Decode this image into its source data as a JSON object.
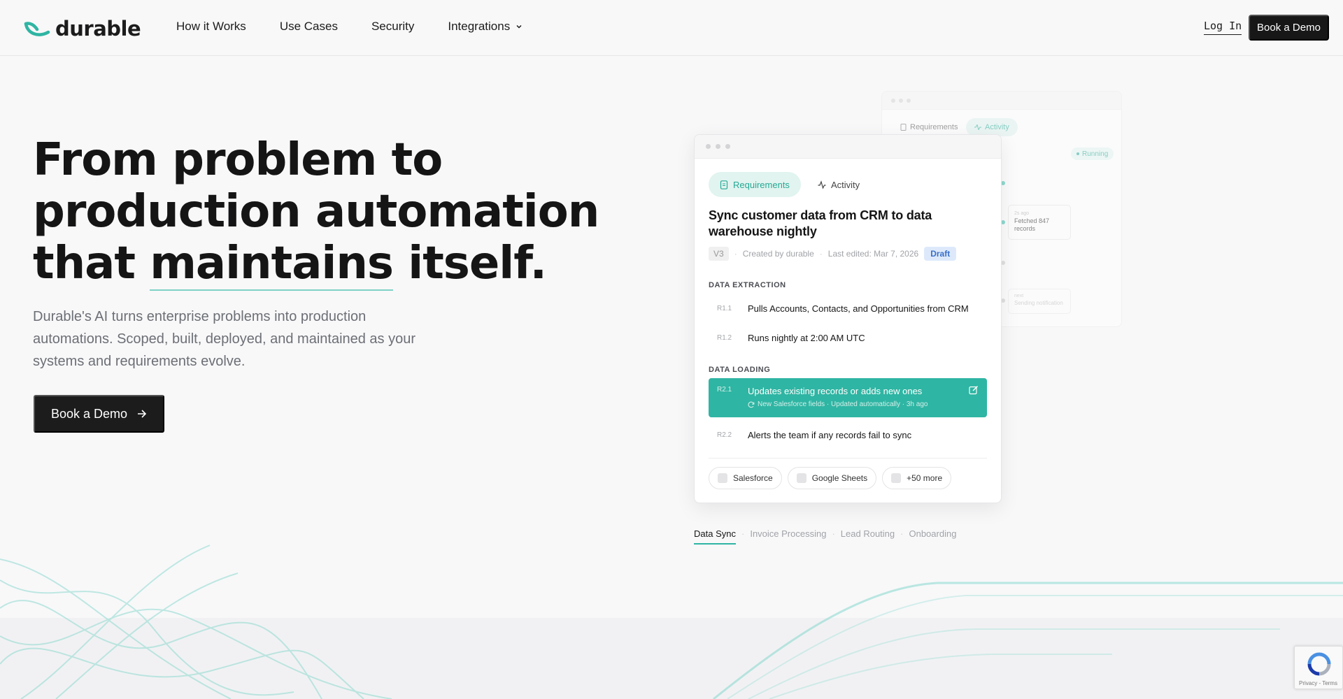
{
  "nav": {
    "logo_text": "durable",
    "links": [
      "How it Works",
      "Use Cases",
      "Security",
      "Integrations"
    ],
    "login": "Log In",
    "demo": "Book a Demo"
  },
  "hero": {
    "title_part1": "From problem to production automation that ",
    "title_highlight": "maintains",
    "title_part2": " itself.",
    "subtitle": "Durable's AI turns enterprise problems into production automations. Scoped, built, deployed, and maintained as your systems and requirements evolve.",
    "cta": "Book a Demo"
  },
  "back_card": {
    "tab_requirements": "Requirements",
    "tab_activity": "Activity",
    "status": "Running",
    "fetch_time": "2s ago",
    "fetch_text": "Fetched 847 records",
    "notify_time": "next",
    "notify_text": "Sending notification"
  },
  "card": {
    "tab_requirements": "Requirements",
    "tab_activity": "Activity",
    "title": "Sync customer data from CRM to data warehouse nightly",
    "version": "V3",
    "created_by": "Created by durable",
    "last_edited": "Last edited: Mar 7, 2026",
    "status": "Draft",
    "sections": [
      {
        "heading": "DATA EXTRACTION",
        "items": [
          {
            "id": "R1.1",
            "text": "Pulls Accounts, Contacts, and Opportunities from CRM"
          },
          {
            "id": "R1.2",
            "text": "Runs nightly at 2:00 AM UTC"
          }
        ]
      },
      {
        "heading": "DATA LOADING",
        "items": [
          {
            "id": "R2.1",
            "text": "Updates existing records or adds new ones",
            "sub": "New Salesforce fields · Updated automatically · 3h ago"
          },
          {
            "id": "R2.2",
            "text": "Alerts the team if any records fail to sync"
          }
        ]
      }
    ],
    "integrations": [
      "Salesforce",
      "Google Sheets",
      "+50 more"
    ]
  },
  "showcase_tabs": [
    "Data Sync",
    "Invoice Processing",
    "Lead Routing",
    "Onboarding"
  ],
  "recaptcha": {
    "text": "Privacy - Terms"
  },
  "colors": {
    "accent": "#2fb5a3",
    "dark": "#171717",
    "draft_bg": "#dde9fb",
    "draft_text": "#3b6fc8"
  }
}
